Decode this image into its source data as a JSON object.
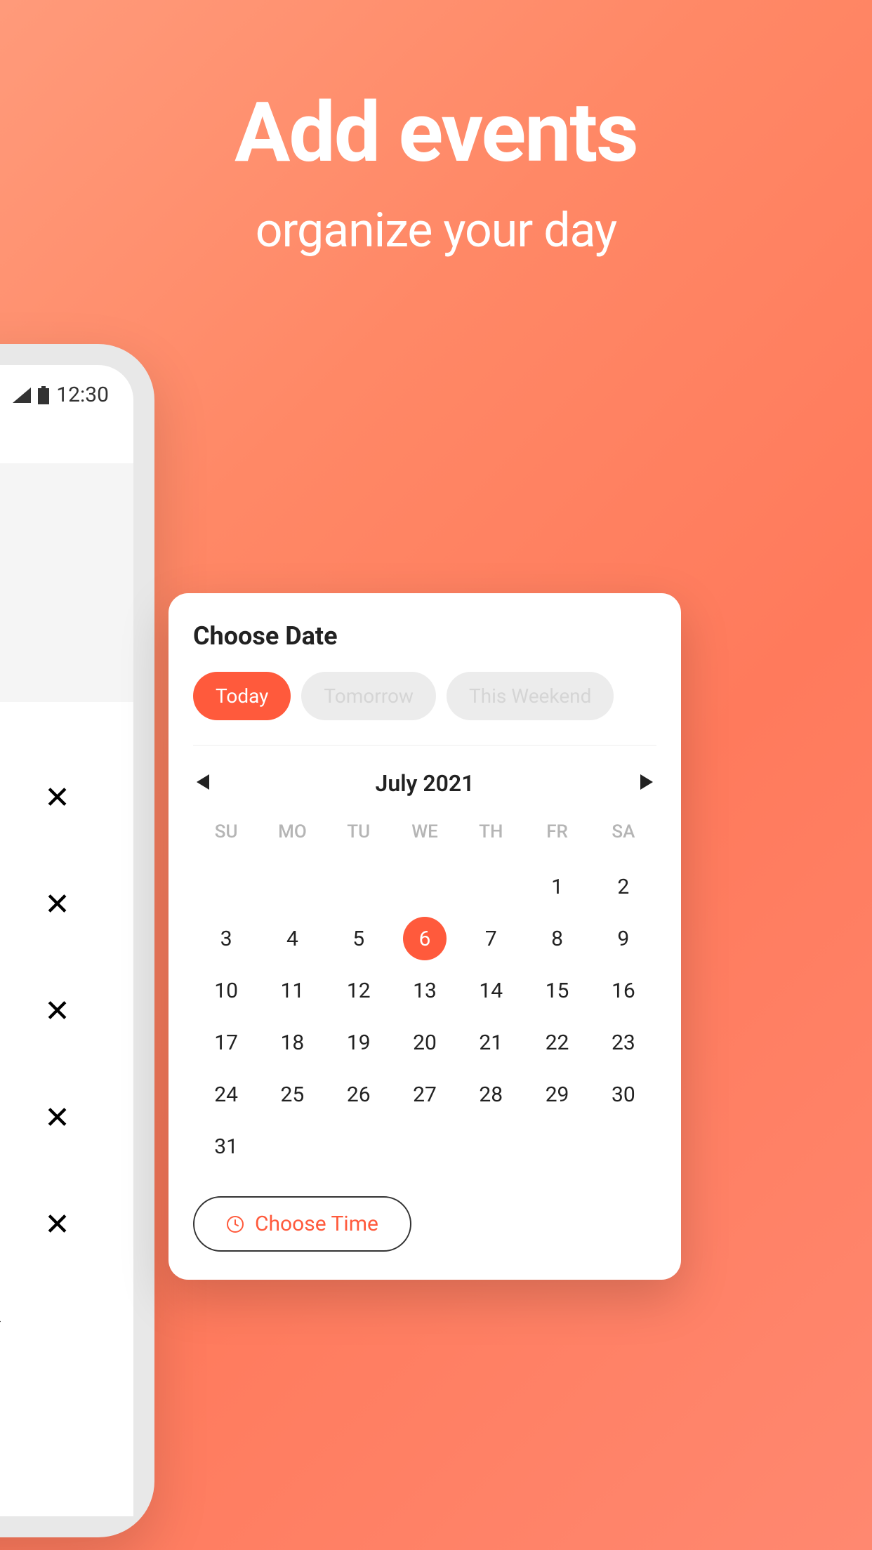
{
  "hero": {
    "title": "Add events",
    "subtitle": "organize your day"
  },
  "statusBar": {
    "time": "12:30"
  },
  "bottomText": "/e",
  "calendar": {
    "title": "Choose Date",
    "chips": {
      "today": "Today",
      "tomorrow": "Tomorrow",
      "weekend": "This Weekend"
    },
    "month": "July 2021",
    "dayHeaders": [
      "SU",
      "MO",
      "TU",
      "WE",
      "TH",
      "FR",
      "SA"
    ],
    "days": [
      "",
      "",
      "",
      "",
      "",
      "1",
      "2",
      "3",
      "4",
      "5",
      "6",
      "7",
      "8",
      "9",
      "10",
      "11",
      "12",
      "13",
      "14",
      "15",
      "16",
      "17",
      "18",
      "19",
      "20",
      "21",
      "22",
      "23",
      "24",
      "25",
      "26",
      "27",
      "28",
      "29",
      "30",
      "31"
    ],
    "selectedDay": "6",
    "chooseTime": "Choose Time"
  },
  "colors": {
    "accent": "#ff5a3c"
  }
}
